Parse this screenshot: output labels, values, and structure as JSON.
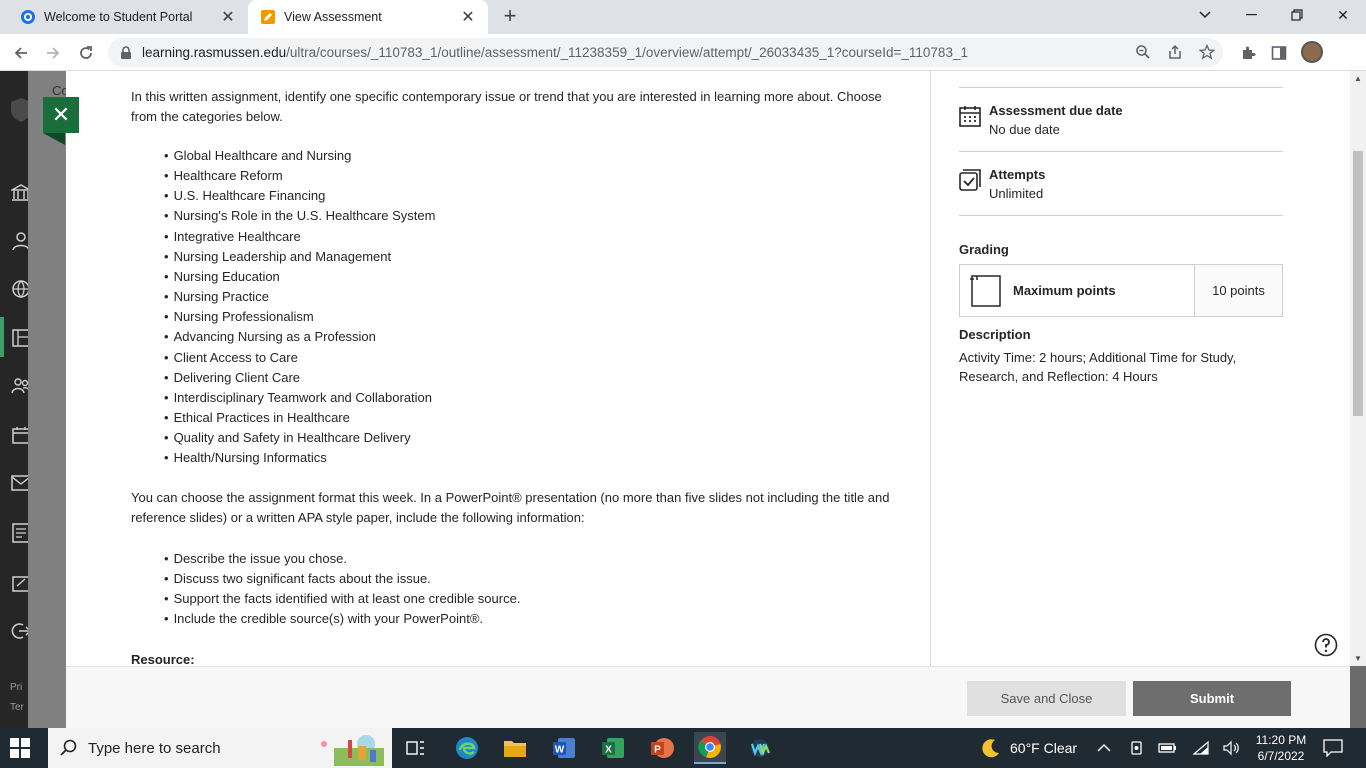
{
  "browser": {
    "tabs": [
      {
        "title": "Welcome to Student Portal",
        "active": false
      },
      {
        "title": "View Assessment",
        "active": true
      }
    ],
    "url_host": "learning.rasmussen.edu",
    "url_path": "/ultra/courses/_110783_1/outline/assessment/_11238359_1/overview/attempt/_26033435_1?courseId=_110783_1"
  },
  "leftnav": {
    "partial_labels": [
      "Co",
      "Pri",
      "Ter"
    ]
  },
  "content": {
    "intro": "In this written assignment, identify one specific contemporary issue or trend that you are interested in learning more about. Choose from the categories below.",
    "categories": [
      "Global Healthcare and Nursing",
      "Healthcare Reform",
      "U.S. Healthcare Financing",
      "Nursing's Role in the U.S. Healthcare System",
      "Integrative Healthcare",
      "Nursing Leadership and Management",
      "Nursing Education",
      "Nursing Practice",
      "Nursing Professionalism",
      "Advancing Nursing as a Profession",
      "Client Access to Care",
      "Delivering Client Care",
      "Interdisciplinary Teamwork and Collaboration",
      "Ethical Practices in Healthcare",
      "Quality and Safety in Healthcare Delivery",
      "Health/Nursing Informatics"
    ],
    "format_text": "You can choose the assignment format this week. In a PowerPoint® presentation (no more than five slides not including the title and reference slides) or a written APA style paper, include the following information:",
    "requirements": [
      "Describe the issue you chose.",
      "Discuss two significant facts about the issue.",
      "Support the facts identified with at least one credible source.",
      "Include the credible source(s) with your PowerPoint®."
    ],
    "resource_heading": "Resource:"
  },
  "details": {
    "due_label": "Assessment due date",
    "due_value": "No due date",
    "attempts_label": "Attempts",
    "attempts_value": "Unlimited",
    "grading_label": "Grading",
    "max_points_label": "Maximum points",
    "max_points_value": "10 points",
    "description_label": "Description",
    "description_text": "Activity Time: 2 hours; Additional Time for Study, Research, and Reflection: 4 Hours"
  },
  "footer": {
    "save_label": "Save and Close",
    "submit_label": "Submit"
  },
  "taskbar": {
    "search_placeholder": "Type here to search",
    "weather": "60°F  Clear",
    "time": "11:20 PM",
    "date": "6/7/2022"
  },
  "colors": {
    "accent_green": "#1a6e3c",
    "submit_gray": "#6e6e6e"
  }
}
